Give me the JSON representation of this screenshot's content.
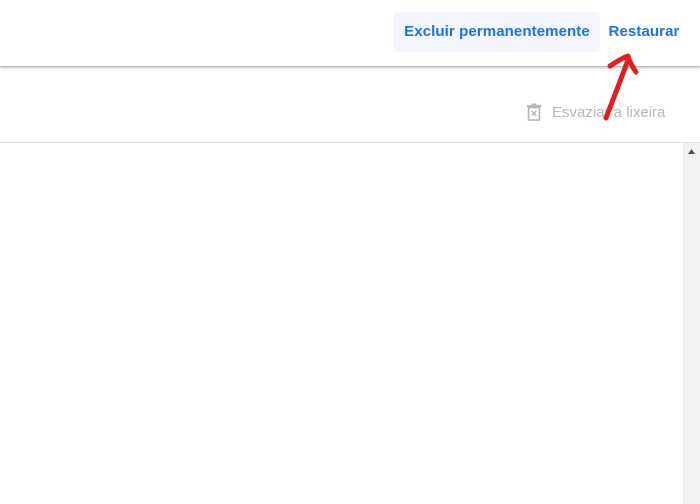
{
  "action_bar": {
    "delete_permanently_label": "Excluir permanentemente",
    "restore_label": "Restaurar"
  },
  "toolbar": {
    "empty_trash_label": "Esvaziar a lixeira",
    "empty_trash_icon": "trash-x-icon"
  },
  "annotation": {
    "type": "red-arrow",
    "color": "#e02020",
    "points_to": "Restaurar"
  },
  "colors": {
    "accent": "#1a73e8",
    "disabled_text": "#b7b7b7",
    "annotation": "#e02020"
  }
}
